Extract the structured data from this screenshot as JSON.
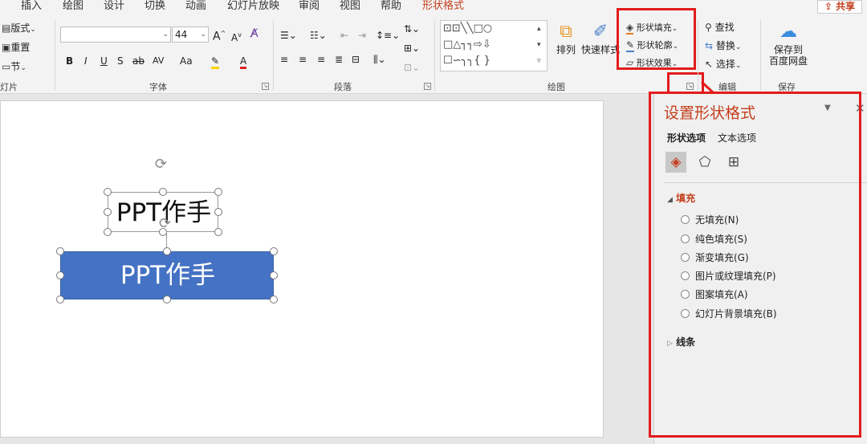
{
  "tabs": [
    "插入",
    "绘图",
    "设计",
    "切换",
    "动画",
    "幻灯片放映",
    "审阅",
    "视图",
    "帮助",
    "形状格式"
  ],
  "active_tab": "形状格式",
  "share_label": "共享",
  "slides_group": {
    "layout_label": "版式",
    "reset_label": "重置",
    "section_label": "节",
    "group_label": "灯片"
  },
  "font_group": {
    "font_name": "",
    "font_size": "44",
    "group_label": "字体",
    "bold": "B",
    "italic": "I",
    "underline": "U",
    "strike_s": "S",
    "strike": "ab",
    "spacing": "AV",
    "case": "Aa",
    "grow": "A",
    "shrink": "A"
  },
  "paragraph_group": {
    "group_label": "段落"
  },
  "drawing_group": {
    "arrange_label": "排列",
    "quick_styles_label": "快速样式",
    "shape_fill_label": "形状填充",
    "shape_outline_label": "形状轮廓",
    "shape_effects_label": "形状效果",
    "group_label": "绘图"
  },
  "editing_group": {
    "find_label": "查找",
    "replace_label": "替换",
    "select_label": "选择",
    "group_label": "编辑"
  },
  "save_group": {
    "save_label_line1": "保存到",
    "save_label_line2": "百度网盘",
    "group_label": "保存"
  },
  "slide": {
    "textbox_text": "PPT作手",
    "rect_text": "PPT作手"
  },
  "format_pane": {
    "title": "设置形状格式",
    "tab_shape": "形状选项",
    "tab_text": "文本选项",
    "fill_section": "填充",
    "fill_options": [
      "无填充(N)",
      "纯色填充(S)",
      "渐变填充(G)",
      "图片或纹理填充(P)",
      "图案填充(A)",
      "幻灯片背景填充(B)"
    ],
    "line_section": "线条"
  },
  "colors": {
    "accent": "#c43e1c",
    "shape_fill": "#4472c4",
    "highlight_box": "#e21b1b"
  }
}
